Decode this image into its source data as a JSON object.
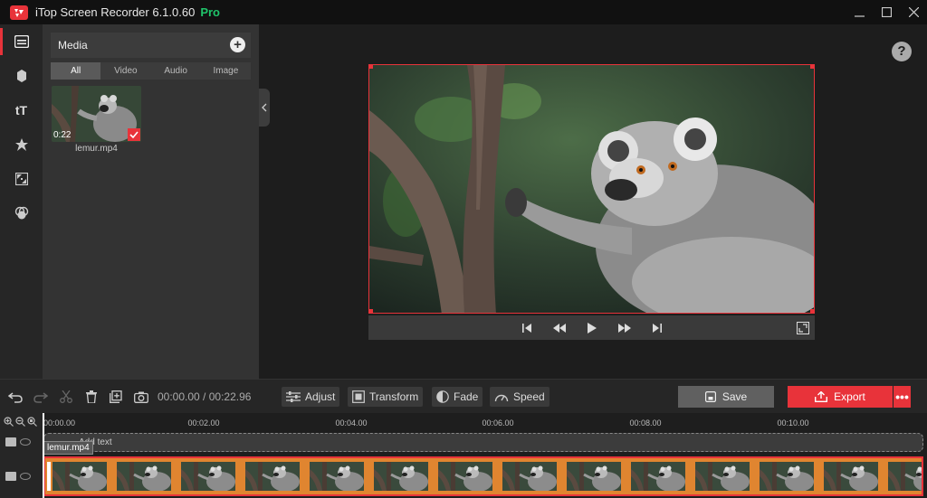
{
  "app": {
    "title": "iTop Screen Recorder 6.1.0.60",
    "badge": "Pro",
    "accent": "#e8333a",
    "pro_color": "#1fc46a"
  },
  "rail": {
    "items": [
      {
        "icon": "media-icon",
        "active": true
      },
      {
        "icon": "effects-icon",
        "active": false
      },
      {
        "icon": "text-icon",
        "label": "tT",
        "active": false
      },
      {
        "icon": "sticker-icon",
        "active": false
      },
      {
        "icon": "transition-icon",
        "active": false
      },
      {
        "icon": "filter-icon",
        "active": false
      }
    ]
  },
  "media": {
    "title": "Media",
    "tabs": [
      "All",
      "Video",
      "Audio",
      "Image"
    ],
    "active_tab": "All",
    "items": [
      {
        "name": "lemur.mp4",
        "duration": "0:22",
        "checked": true
      }
    ]
  },
  "player": {
    "controls": [
      "skip-start-icon",
      "rewind-icon",
      "play-icon",
      "fast-forward-icon",
      "skip-end-icon"
    ]
  },
  "toolbar": {
    "time_current": "00:00.00",
    "time_total": "00:22.96",
    "adjust_label": "Adjust",
    "transform_label": "Transform",
    "fade_label": "Fade",
    "speed_label": "Speed",
    "save_label": "Save",
    "export_label": "Export",
    "more_label": "•••"
  },
  "timeline": {
    "ticks": [
      "00:00.00",
      "00:02.00",
      "00:04.00",
      "00:06.00",
      "00:08.00",
      "00:10.00"
    ],
    "text_track_label": "Add text",
    "clip_name": "lemur.mp4",
    "help_label": "?"
  }
}
